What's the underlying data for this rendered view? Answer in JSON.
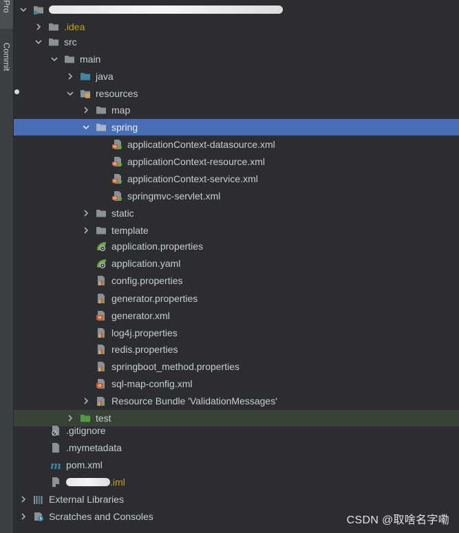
{
  "sidebar": {
    "project_tab": "Pro",
    "commit_tab": "Commit"
  },
  "tree": {
    "idea": ".idea",
    "src": "src",
    "main": "main",
    "java": "java",
    "resources": "resources",
    "map": "map",
    "spring": "spring",
    "spring_files": [
      "applicationContext-datasource.xml",
      "applicationContext-resource.xml",
      "applicationContext-service.xml",
      "springmvc-servlet.xml"
    ],
    "static": "static",
    "template": "template",
    "resource_files": [
      "application.properties",
      "application.yaml",
      "config.properties",
      "generator.properties",
      "generator.xml",
      "log4j.properties",
      "redis.properties",
      "springboot_method.properties",
      "sql-map-config.xml"
    ],
    "bundle": "Resource Bundle 'ValidationMessages'",
    "test": "test",
    "gitignore": ".gitignore",
    "mymetadata": ".mymetadata",
    "pom": "pom.xml",
    "iml_suffix": ".iml",
    "external_libraries": "External Libraries",
    "scratches": "Scratches and Consoles"
  },
  "watermark": "CSDN @取啥名字嘞",
  "colors": {
    "background": "#2b2d30",
    "selection": "#4a6eb5",
    "test_highlight": "#394236",
    "excluded_text": "#c3a21d",
    "folder": "#8d9194",
    "source_folder": "#3e86a0",
    "test_folder": "#4f9a44"
  }
}
